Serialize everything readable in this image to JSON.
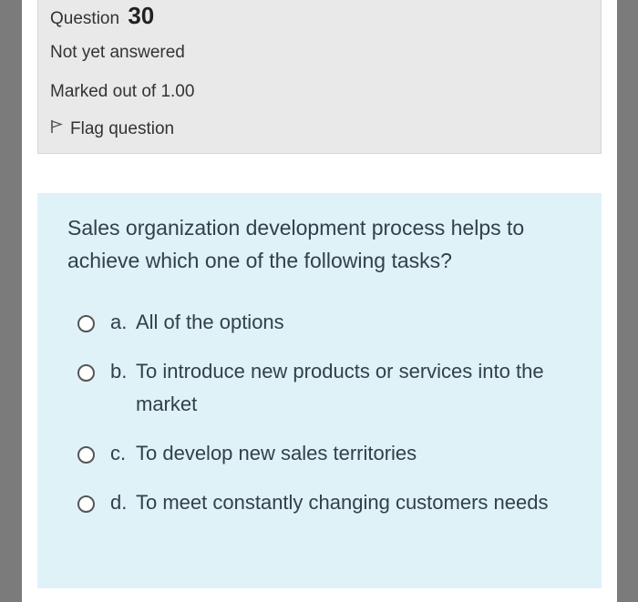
{
  "info": {
    "question_label": "Question",
    "question_number": "30",
    "status": "Not yet answered",
    "marks": "Marked out of 1.00",
    "flag_label": "Flag question",
    "flag_icon": "flag-icon"
  },
  "question": {
    "text": "Sales organization development process helps to achieve which one of the following tasks?",
    "options": [
      {
        "letter": "a.",
        "text": "All of the options"
      },
      {
        "letter": "b.",
        "text": "To introduce new products or services into the market"
      },
      {
        "letter": "c.",
        "text": "To develop new sales territories"
      },
      {
        "letter": "d.",
        "text": "To meet constantly changing customers needs"
      }
    ]
  },
  "colors": {
    "info_bg": "#e9e9e9",
    "question_bg": "#def2f8",
    "side_bars": "#7b7b7b",
    "text": "#33404a"
  }
}
